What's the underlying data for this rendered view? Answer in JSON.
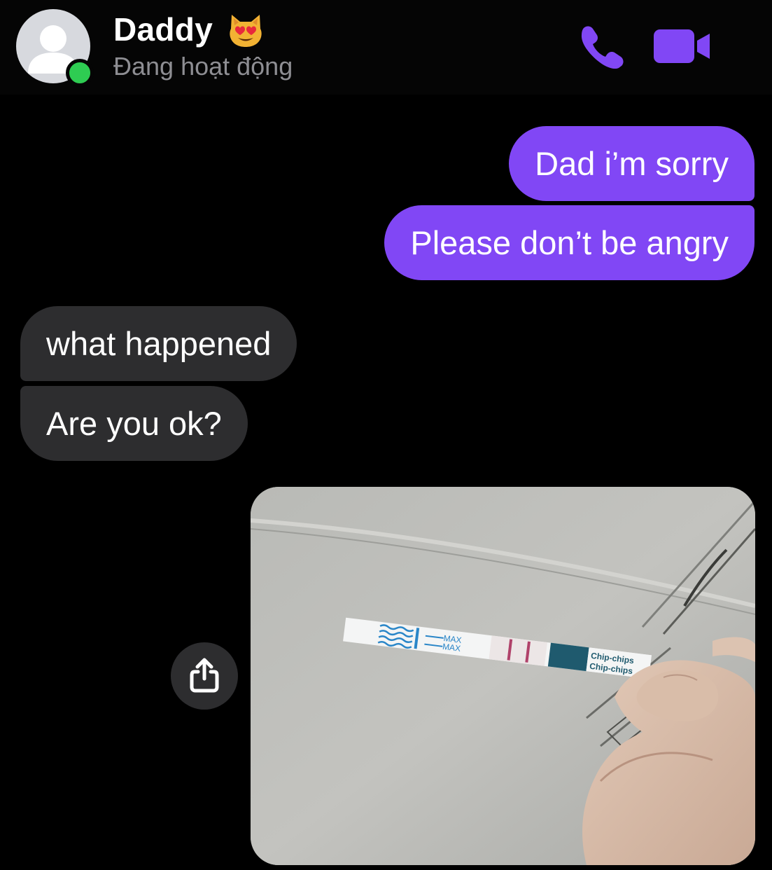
{
  "header": {
    "contact_name": "Daddy",
    "status": "Đang hoạt động",
    "status_color": "#8e8e93",
    "presence_color": "#2ecc52",
    "accent_color": "#8147f5",
    "icons": [
      "phone-icon",
      "video-camera-icon"
    ]
  },
  "messages": [
    {
      "direction": "sent",
      "text": "Dad i’m sorry"
    },
    {
      "direction": "sent",
      "text": "Please don’t be angry"
    },
    {
      "direction": "received",
      "text": "what happened"
    },
    {
      "direction": "received",
      "text": "Are you ok?"
    }
  ],
  "photo": {
    "strip_text": {
      "max_1": "MAX",
      "max_2": "MAX",
      "brand_1": "Chip-chips",
      "brand_2": "Chip-chips"
    }
  },
  "colors": {
    "sent_bubble": "#8147f5",
    "received_bubble": "#2d2d2f",
    "background": "#000000"
  }
}
